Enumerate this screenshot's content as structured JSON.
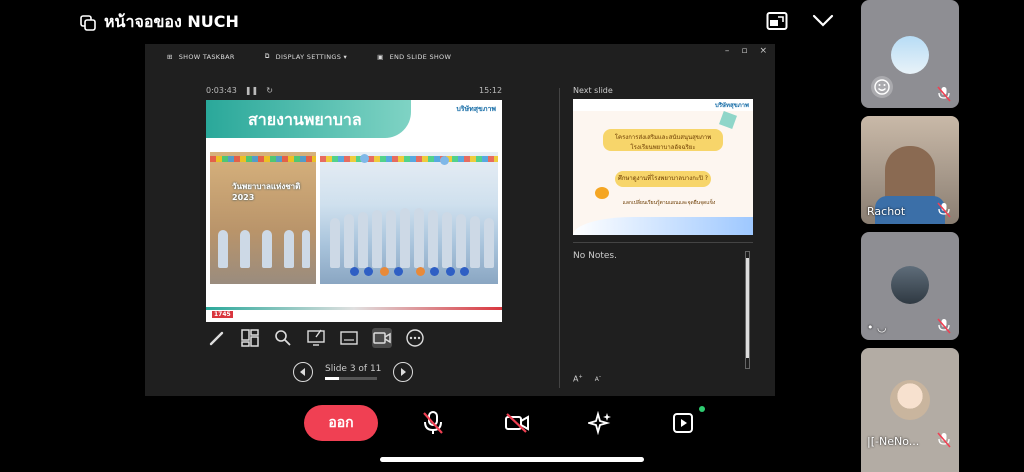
{
  "header": {
    "title": "หน้าจอของ NUCH"
  },
  "presenter": {
    "toolbar": [
      "SHOW TASKBAR",
      "DISPLAY SETTINGS ▾",
      "END SLIDE SHOW"
    ],
    "elapsed": "0:03:43",
    "clock": "15:12",
    "current_slide": {
      "heading": "สายงานพยาบาล",
      "logo_text": "บริษัทสุขภาพ",
      "banner_text": "วันพยาบาลแห่งชาติ 2023",
      "footer_logo": "1745"
    },
    "slide_counter": "Slide 3 of 11",
    "slide_progress": 0.27,
    "next_label": "Next slide",
    "next_slide": {
      "logo_text": "บริษัทสุขภาพ",
      "line1": "โครงการส่งเสริมและสนับสนุนสุขภาพ",
      "line2": "โรงเรียนพยาบาลอัจฉริยะ",
      "line3": "ศึกษาดูงานที่โรงพยาบาลบางกะปิ ?",
      "line4": "แลกเปลี่ยนเรียนรู้ตามแผนและจุดยืนจุดแข็ง"
    },
    "notes": "No Notes."
  },
  "controls": {
    "leave_label": "ออก"
  },
  "participants": [
    {
      "name": ""
    },
    {
      "name": "Rachot"
    },
    {
      "name": "•  ◡"
    },
    {
      "name": "|[-NeNo..."
    }
  ],
  "colors": {
    "leave": "#f04053",
    "banner": "#2aa89a",
    "present_dot": "#2ecc71"
  }
}
